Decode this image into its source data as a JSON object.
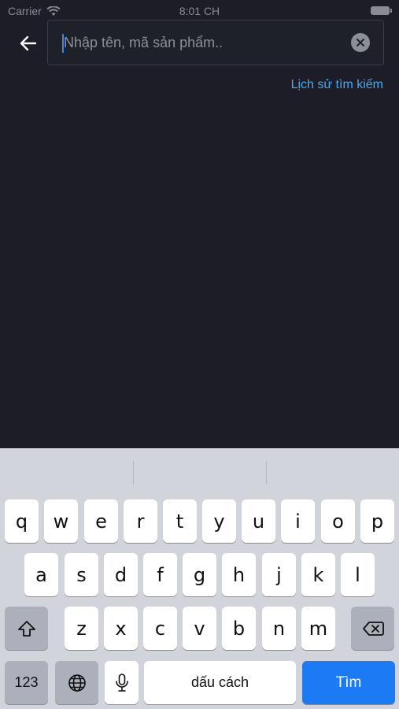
{
  "status_bar": {
    "carrier": "Carrier",
    "time": "8:01 CH"
  },
  "search": {
    "placeholder": "Nhập tên, mã sản phẩm..",
    "value": ""
  },
  "history_link": "Lịch sử tìm kiếm",
  "keyboard": {
    "row1": [
      "q",
      "w",
      "e",
      "r",
      "t",
      "y",
      "u",
      "i",
      "o",
      "p"
    ],
    "row2": [
      "a",
      "s",
      "d",
      "f",
      "g",
      "h",
      "j",
      "k",
      "l"
    ],
    "row3": [
      "z",
      "x",
      "c",
      "v",
      "b",
      "n",
      "m"
    ],
    "numbers_label": "123",
    "space_label": "dấu cách",
    "return_label": "Tìm"
  },
  "colors": {
    "background": "#1c1d26",
    "accent": "#4aa8f0",
    "return_key": "#1d7af5"
  }
}
